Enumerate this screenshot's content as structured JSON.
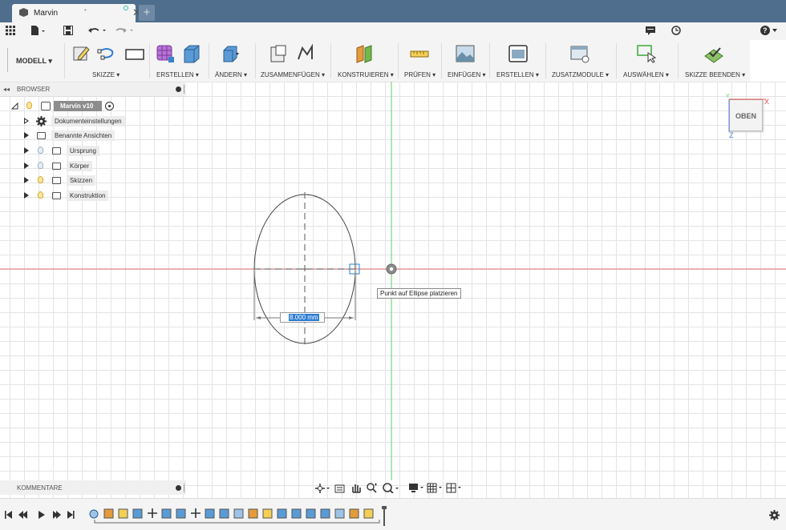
{
  "window": {
    "tab_title": "Marvin",
    "tab_dot": "•",
    "close_glyph": "✕",
    "new_tab_glyph": "+"
  },
  "quick": {
    "grid_icon": "apps-grid-icon",
    "help_glyph": "?"
  },
  "ribbon": {
    "workspace": "MODELL ▾",
    "groups": [
      "SKIZZE ▾",
      "ERSTELLEN ▾",
      "ÄNDERN ▾",
      "ZUSAMMENFÜGEN ▾",
      "KONSTRUIEREN ▾",
      "PRÜFEN ▾",
      "EINFÜGEN ▾",
      "ERSTELLEN ▾",
      "ZUSATZMODULE ▾",
      "AUSWÄHLEN ▾",
      "SKIZZE BEENDEN ▾"
    ]
  },
  "browser": {
    "header": "BROWSER",
    "collapse_glyph": "◂◂",
    "root": "Marvin v10",
    "items": [
      "Dokumenteinstellungen",
      "Benannte Ansichten",
      "Ursprung",
      "Körper",
      "Skizzen",
      "Konstruktion"
    ]
  },
  "comments": {
    "header": "KOMMENTARE"
  },
  "canvas": {
    "tooltip": "Punkt auf Ellipse platzieren",
    "dimension_value": "8.000 mm",
    "viewcube_face": "OBEN",
    "axis_x": "X",
    "axis_y": "Y",
    "axis_z": "Z"
  },
  "colors": {
    "title_bar": "#4f6d8c",
    "x_axis": "#e07070",
    "y_axis": "#5ccf5c",
    "selection": "#2b7cd3"
  }
}
